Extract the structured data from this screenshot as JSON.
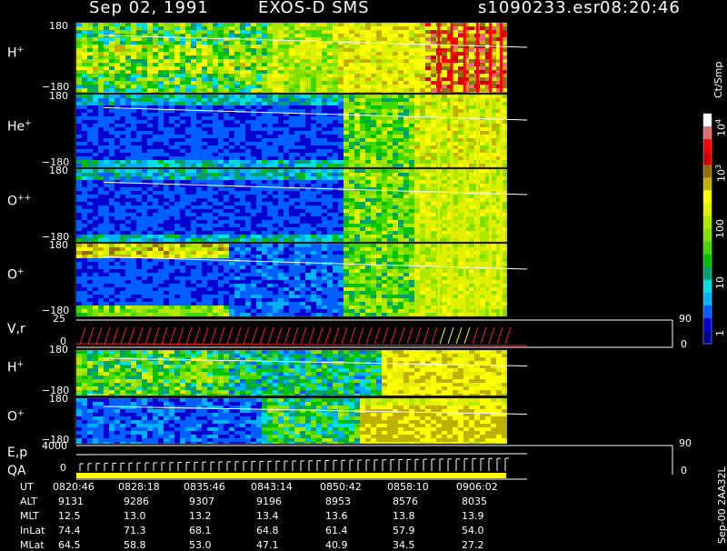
{
  "header": {
    "date": "Sep 02, 1991",
    "instrument": "EXOS-D SMS",
    "file": "s1090233.esr",
    "time": "08:20:46"
  },
  "panels": [
    {
      "label": "H",
      "sup": "+",
      "ytop": "180",
      "ybot": "−180"
    },
    {
      "label": "He",
      "sup": "+",
      "ytop": "180",
      "ybot": "−180"
    },
    {
      "label": "O",
      "sup": "++",
      "ytop": "180",
      "ybot": "−180"
    },
    {
      "label": "O",
      "sup": "+",
      "ytop": "180",
      "ybot": "−180"
    },
    {
      "label": "V,r",
      "sup": "",
      "ytop": "25",
      "ybot": "0"
    },
    {
      "label": "H",
      "sup": "+",
      "ytop": "180",
      "ybot": "−180"
    },
    {
      "label": "O",
      "sup": "+",
      "ytop": "180",
      "ybot": "−180"
    },
    {
      "label": "E,p",
      "sup": "",
      "ytop": "4000",
      "ybot": "0"
    }
  ],
  "qa_label": "QA",
  "right_axis": {
    "vr_top": "90",
    "vr_bot": "0",
    "ep_top": "90",
    "ep_bot": "0"
  },
  "colorbar": {
    "unit": "Ct/Smp",
    "ticks": [
      "1",
      "10",
      "100",
      "10",
      "10"
    ],
    "tick_sups": [
      "",
      "",
      "",
      "3",
      "4"
    ],
    "colors": [
      "#000090",
      "#0000d0",
      "#0060ff",
      "#00b0ff",
      "#00e0e0",
      "#00a070",
      "#00c000",
      "#40d800",
      "#80e000",
      "#b0e800",
      "#e0f000",
      "#ffff00",
      "#c0b000",
      "#907000",
      "#d00000",
      "#ff0000",
      "#e07070",
      "#ffffff"
    ]
  },
  "side_label": "Sep-00  2AA32L",
  "footer": {
    "row_labels": [
      "UT",
      "ALT",
      "MLT",
      "InLat",
      "MLat"
    ],
    "ut": [
      "0820:46",
      "0828:18",
      "0835:46",
      "0843:14",
      "0850:42",
      "0858:10",
      "0906:02"
    ],
    "alt": [
      "9131",
      "9286",
      "9307",
      "9196",
      "8953",
      "8576",
      "8035"
    ],
    "mlt": [
      "12.5",
      "13.0",
      "13.2",
      "13.4",
      "13.6",
      "13.8",
      "13.9"
    ],
    "inlat": [
      "74.4",
      "71.3",
      "68.1",
      "64.8",
      "61.4",
      "57.9",
      "54.0"
    ],
    "mlat": [
      "64.5",
      "58.8",
      "53.0",
      "47.1",
      "40.9",
      "34.5",
      "27.2"
    ]
  },
  "chart_data": {
    "type": "heatmap",
    "title": "Sep 02, 1991   EXOS-D SMS",
    "x_time_ut": [
      "0820:46",
      "0828:18",
      "0835:46",
      "0843:14",
      "0850:42",
      "0858:10",
      "0906:02"
    ],
    "x_alt": [
      9131,
      9286,
      9307,
      9196,
      8953,
      8576,
      8035
    ],
    "x_mlt": [
      12.5,
      13.0,
      13.2,
      13.4,
      13.6,
      13.8,
      13.9
    ],
    "x_inlat": [
      74.4,
      71.3,
      68.1,
      64.8,
      61.4,
      57.9,
      54.0
    ],
    "x_mlat": [
      64.5,
      58.8,
      53.0,
      47.1,
      40.9,
      34.5,
      27.2
    ],
    "series": [
      {
        "name": "H+",
        "ylim": [
          -180,
          180
        ]
      },
      {
        "name": "He+",
        "ylim": [
          -180,
          180
        ]
      },
      {
        "name": "O++",
        "ylim": [
          -180,
          180
        ]
      },
      {
        "name": "O+",
        "ylim": [
          -180,
          180
        ]
      },
      {
        "name": "V,r",
        "ylim": [
          0,
          25
        ],
        "right_ylim": [
          0,
          90
        ]
      },
      {
        "name": "H+",
        "ylim": [
          -180,
          180
        ]
      },
      {
        "name": "O+",
        "ylim": [
          -180,
          180
        ]
      },
      {
        "name": "E,p",
        "ylim": [
          0,
          4000
        ],
        "right_ylim": [
          0,
          90
        ]
      }
    ],
    "colorbar_unit": "Ct/Smp",
    "colorbar_scale": "log",
    "colorbar_range": [
      1,
      10000
    ]
  }
}
